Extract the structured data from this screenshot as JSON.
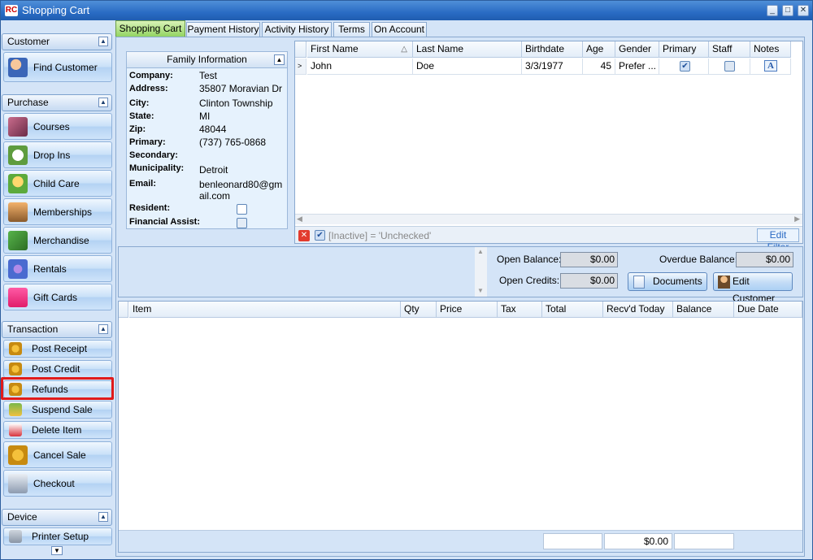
{
  "window": {
    "title": "Shopping Cart",
    "logo": "RC"
  },
  "sidebar": {
    "groups": {
      "customer": "Customer",
      "purchase": "Purchase",
      "transaction": "Transaction",
      "device": "Device"
    },
    "customer_items": [
      {
        "label": "Find Customer",
        "icon": "find-customer-icon"
      }
    ],
    "purchase_items": [
      {
        "label": "Courses",
        "icon": "courses-icon"
      },
      {
        "label": "Drop Ins",
        "icon": "clock-icon"
      },
      {
        "label": "Child Care",
        "icon": "child-care-icon"
      },
      {
        "label": "Memberships",
        "icon": "memberships-icon"
      },
      {
        "label": "Merchandise",
        "icon": "merchandise-icon"
      },
      {
        "label": "Rentals",
        "icon": "rentals-icon"
      },
      {
        "label": "Gift Cards",
        "icon": "gift-icon"
      }
    ],
    "transaction_items": [
      {
        "label": "Post Receipt",
        "icon": "post-receipt-icon"
      },
      {
        "label": "Post Credit",
        "icon": "post-credit-icon"
      },
      {
        "label": "Refunds",
        "icon": "refunds-icon"
      },
      {
        "label": "Suspend Sale",
        "icon": "suspend-sale-icon"
      },
      {
        "label": "Delete Item",
        "icon": "delete-item-icon"
      },
      {
        "label": "Cancel Sale",
        "icon": "cancel-sale-icon"
      },
      {
        "label": "Checkout",
        "icon": "checkout-icon"
      }
    ],
    "device_items": [
      {
        "label": "Printer Setup",
        "icon": "printer-icon"
      }
    ]
  },
  "tabs": [
    "Shopping Cart",
    "Payment History",
    "Activity History",
    "Terms",
    "On Account"
  ],
  "family": {
    "header": "Family Information",
    "labels": {
      "company": "Company:",
      "address": "Address:",
      "city": "City:",
      "state": "State:",
      "zip": "Zip:",
      "primary": "Primary:",
      "secondary": "Secondary:",
      "municipality": "Municipality:",
      "email": "Email:",
      "resident": "Resident:",
      "financial": "Financial Assist:"
    },
    "values": {
      "company": "Test",
      "address": "35807 Moravian Dr",
      "city": "Clinton Township",
      "state": "MI",
      "zip": "48044",
      "primary": "(737) 765-0868",
      "secondary": "",
      "municipality": "Detroit",
      "email": "benleonard80@gmail.com"
    }
  },
  "members": {
    "columns": [
      "First Name",
      "Last Name",
      "Birthdate",
      "Age",
      "Gender",
      "Primary",
      "Staff",
      "Notes"
    ],
    "rows": [
      {
        "first": "John",
        "last": "Doe",
        "birthdate": "3/3/1977",
        "age": "45",
        "gender": "Prefer ...",
        "primary": true,
        "staff": false
      }
    ],
    "filter_text": "[Inactive] = 'Unchecked'",
    "edit_filter": "Edit Filter"
  },
  "balances": {
    "open_balance_label": "Open Balance:",
    "open_balance": "$0.00",
    "overdue_label": "Overdue Balance:",
    "overdue": "$0.00",
    "open_credits_label": "Open Credits:",
    "open_credits": "$0.00",
    "documents": "Documents",
    "edit_customer": "Edit Customer"
  },
  "items": {
    "columns": [
      "Item",
      "Qty",
      "Price",
      "Tax",
      "Total",
      "Recv'd Today",
      "Balance",
      "Due Date"
    ],
    "footer_total": "$0.00"
  }
}
